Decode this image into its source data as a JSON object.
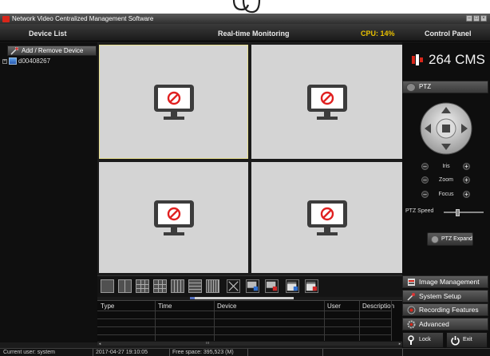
{
  "window": {
    "title": "Network Video Centralized Management Software"
  },
  "header": {
    "device_list": "Device List",
    "realtime": "Real-time Monitoring",
    "cpu": "CPU: 14%",
    "control_panel": "Control Panel"
  },
  "left": {
    "add_remove": "Add / Remove Device",
    "device": "d00408267"
  },
  "brand": {
    "text": "264 CMS"
  },
  "ptz": {
    "label": "PTZ",
    "iris": "Iris",
    "zoom": "Zoom",
    "focus": "Focus",
    "speed_label": "PTZ Speed",
    "speed_value": 0.3,
    "expand": "PTZ Expand"
  },
  "menu": {
    "image_mgmt": "Image Management",
    "system_setup": "System Setup",
    "recording": "Recording Features",
    "advanced": "Advanced",
    "lock": "Lock",
    "exit": "Exit"
  },
  "log": {
    "cols": [
      "Type",
      "Time",
      "Device",
      "User",
      "Description"
    ]
  },
  "status": {
    "user": "Current user: system",
    "time": "2017-04-27 19:10:05",
    "space": "Free space: 395,523 (M)"
  },
  "colors": {
    "accent": "#e8c000",
    "brand_red": "#d8261a"
  }
}
